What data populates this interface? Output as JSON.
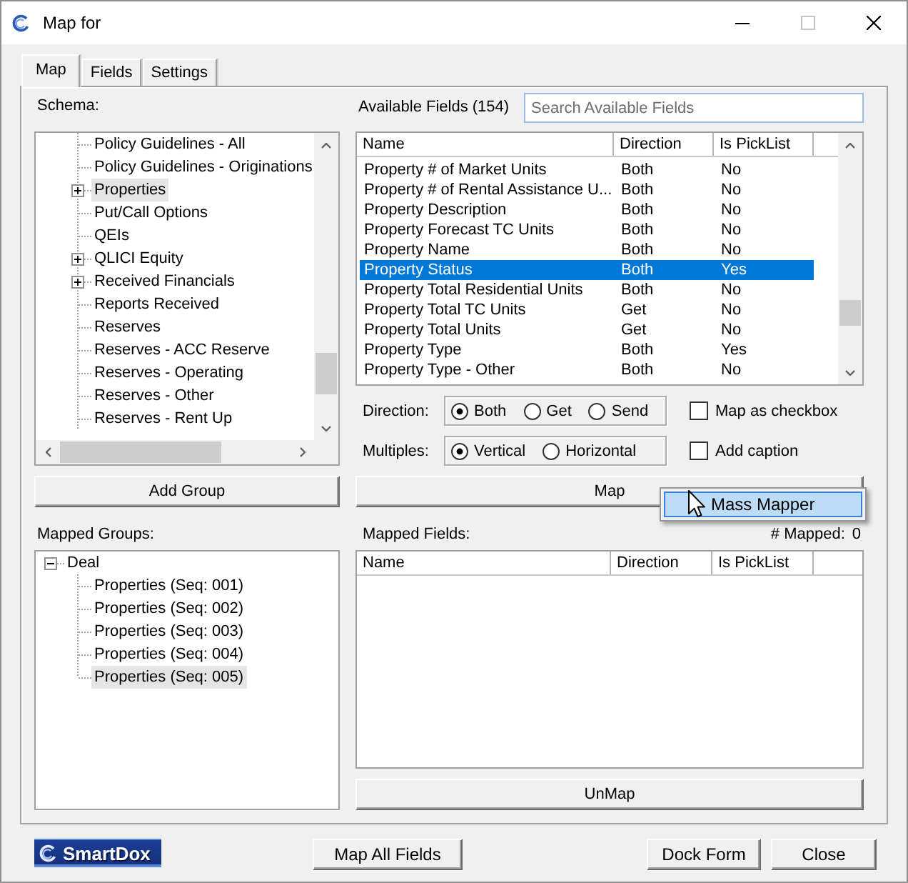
{
  "window": {
    "title": "Map for",
    "controls": [
      {
        "kind": "minimize",
        "disabled": false
      },
      {
        "kind": "maximize",
        "disabled": true
      },
      {
        "kind": "close",
        "disabled": false
      }
    ]
  },
  "tabs": [
    {
      "label": "Map",
      "selected": true
    },
    {
      "label": "Fields",
      "selected": false
    },
    {
      "label": "Settings",
      "selected": false
    }
  ],
  "schema": {
    "label": "Schema:",
    "items": [
      {
        "label": "Policy Guidelines - All",
        "expandable": false,
        "selected": false
      },
      {
        "label": "Policy Guidelines - Originations",
        "expandable": false,
        "selected": false
      },
      {
        "label": "Properties",
        "expandable": true,
        "selected": true
      },
      {
        "label": "Put/Call Options",
        "expandable": false,
        "selected": false
      },
      {
        "label": "QEIs",
        "expandable": false,
        "selected": false
      },
      {
        "label": "QLICI Equity",
        "expandable": true,
        "selected": false
      },
      {
        "label": "Received Financials",
        "expandable": true,
        "selected": false
      },
      {
        "label": "Reports Received",
        "expandable": false,
        "selected": false
      },
      {
        "label": "Reserves",
        "expandable": false,
        "selected": false
      },
      {
        "label": "Reserves - ACC Reserve",
        "expandable": false,
        "selected": false
      },
      {
        "label": "Reserves - Operating",
        "expandable": false,
        "selected": false
      },
      {
        "label": "Reserves - Other",
        "expandable": false,
        "selected": false
      },
      {
        "label": "Reserves - Rent Up",
        "expandable": false,
        "selected": false
      }
    ],
    "button": "Add Group"
  },
  "mapped_groups": {
    "label": "Mapped Groups:",
    "items": [
      {
        "label": "Deal",
        "expanded": true,
        "selected": false,
        "children": [
          {
            "label": "Properties (Seq: 001)",
            "selected": false
          },
          {
            "label": "Properties (Seq: 002)",
            "selected": false
          },
          {
            "label": "Properties (Seq: 003)",
            "selected": false
          },
          {
            "label": "Properties (Seq: 004)",
            "selected": false
          },
          {
            "label": "Properties (Seq: 005)",
            "selected": true
          }
        ]
      }
    ]
  },
  "available_fields": {
    "label": "Available Fields (154)",
    "search": {
      "placeholder": "Search Available Fields"
    },
    "columns": [
      "Name",
      "Direction",
      "Is PickList"
    ],
    "rows": [
      {
        "cells": [
          "Property # of Market Units",
          "Both",
          "No"
        ],
        "selected": false
      },
      {
        "cells": [
          "Property # of Rental Assistance U...",
          "Both",
          "No"
        ],
        "selected": false
      },
      {
        "cells": [
          "Property Description",
          "Both",
          "No"
        ],
        "selected": false
      },
      {
        "cells": [
          "Property Forecast TC Units",
          "Both",
          "No"
        ],
        "selected": false
      },
      {
        "cells": [
          "Property Name",
          "Both",
          "No"
        ],
        "selected": false
      },
      {
        "cells": [
          "Property Status",
          "Both",
          "Yes"
        ],
        "selected": true
      },
      {
        "cells": [
          "Property Total Residential Units",
          "Both",
          "No"
        ],
        "selected": false
      },
      {
        "cells": [
          "Property Total TC Units",
          "Get",
          "No"
        ],
        "selected": false
      },
      {
        "cells": [
          "Property Total Units",
          "Get",
          "No"
        ],
        "selected": false
      },
      {
        "cells": [
          "Property Type",
          "Both",
          "Yes"
        ],
        "selected": false
      },
      {
        "cells": [
          "Property Type - Other",
          "Both",
          "No"
        ],
        "selected": false
      }
    ]
  },
  "direction": {
    "label": "Direction:",
    "options": [
      {
        "label": "Both",
        "selected": true
      },
      {
        "label": "Get",
        "selected": false
      },
      {
        "label": "Send",
        "selected": false
      }
    ]
  },
  "multiples": {
    "label": "Multiples:",
    "options": [
      {
        "label": "Vertical",
        "selected": true
      },
      {
        "label": "Horizontal",
        "selected": false
      }
    ]
  },
  "checkboxes": [
    {
      "label": "Map as checkbox",
      "checked": false
    },
    {
      "label": "Add caption",
      "checked": false
    }
  ],
  "map_button": "Map",
  "context_menu": {
    "items": [
      {
        "label": "Mass Mapper",
        "selected": true
      }
    ]
  },
  "mapped_fields": {
    "label": "Mapped Fields:",
    "count_label": "# Mapped:",
    "count": "0",
    "columns": [
      "Name",
      "Direction",
      "Is PickList"
    ]
  },
  "unmap_button": "UnMap",
  "footer": {
    "logo": "SmartDox",
    "buttons": [
      "Map All Fields",
      "Dock Form",
      "Close"
    ]
  }
}
